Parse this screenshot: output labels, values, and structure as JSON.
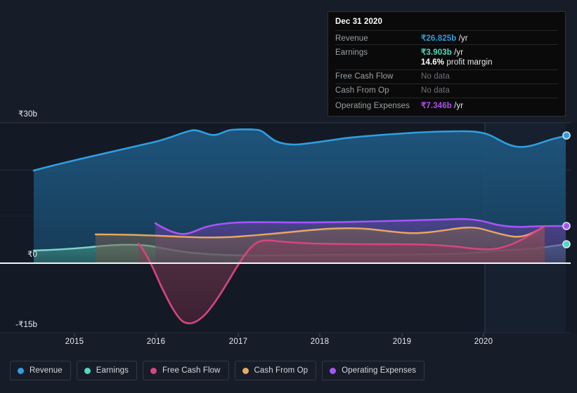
{
  "tooltip": {
    "title": "Dec 31 2020",
    "rows": [
      {
        "key": "Revenue",
        "value": "₹26.825b",
        "unit": " /yr",
        "color": "#2f9fe0",
        "muted": false
      },
      {
        "key": "Earnings",
        "value": "₹3.903b",
        "unit": " /yr",
        "color": "#4fd9c0",
        "muted": false
      },
      {
        "key": "",
        "value": "14.6%",
        "unit": " profit margin",
        "color": "#ffffff",
        "muted": false
      },
      {
        "key": "Free Cash Flow",
        "value": "No data",
        "unit": "",
        "color": "#6b7078",
        "muted": true
      },
      {
        "key": "Cash From Op",
        "value": "No data",
        "unit": "",
        "color": "#6b7078",
        "muted": true
      },
      {
        "key": "Operating Expenses",
        "value": "₹7.346b",
        "unit": " /yr",
        "color": "#b24ff0",
        "muted": false
      }
    ]
  },
  "legend": {
    "items": [
      {
        "label": "Revenue",
        "color": "#2f9fe0"
      },
      {
        "label": "Earnings",
        "color": "#4fd9c0"
      },
      {
        "label": "Free Cash Flow",
        "color": "#d6457f"
      },
      {
        "label": "Cash From Op",
        "color": "#e9a martial"
      },
      {
        "label": "Operating Expenses",
        "color": "#a855f7"
      }
    ]
  },
  "chart_data": {
    "type": "area",
    "title": "",
    "xlabel": "",
    "ylabel": "",
    "ylim": [
      -15,
      30
    ],
    "y_ticks": [
      30,
      0,
      -15
    ],
    "y_tick_labels": [
      "₹30b",
      "₹0",
      "-₹15b"
    ],
    "x_ticks": [
      "2015",
      "2016",
      "2017",
      "2018",
      "2019",
      "2020"
    ],
    "xlim": [
      "2014.5",
      "2021.0"
    ],
    "currency": "₹",
    "units": "billions",
    "grid": true,
    "legend_position": "bottom",
    "series": [
      {
        "name": "Revenue",
        "color": "#2f9fe0",
        "fill": "#1d4a6b",
        "points": [
          [
            2014.62,
            19.8
          ],
          [
            2015.0,
            21.2
          ],
          [
            2015.4,
            22.3
          ],
          [
            2015.8,
            23.5
          ],
          [
            2016.0,
            24.2
          ],
          [
            2016.2,
            25.3
          ],
          [
            2016.4,
            24.6
          ],
          [
            2016.6,
            24.2
          ],
          [
            2016.8,
            27.0
          ],
          [
            2017.0,
            27.8
          ],
          [
            2017.2,
            27.9
          ],
          [
            2017.45,
            27.7
          ],
          [
            2017.7,
            26.0
          ],
          [
            2018.0,
            25.6
          ],
          [
            2018.4,
            25.9
          ],
          [
            2018.7,
            26.6
          ],
          [
            2019.0,
            26.8
          ],
          [
            2019.4,
            27.1
          ],
          [
            2019.8,
            27.6
          ],
          [
            2020.1,
            27.8
          ],
          [
            2020.4,
            26.6
          ],
          [
            2020.6,
            25.9
          ],
          [
            2020.8,
            26.4
          ],
          [
            2021.0,
            26.825
          ]
        ]
      },
      {
        "name": "Earnings",
        "color": "#7fd6cd",
        "fill": "#2f6a66",
        "points": [
          [
            2014.62,
            2.6
          ],
          [
            2015.0,
            2.5
          ],
          [
            2015.4,
            2.5
          ],
          [
            2015.8,
            2.8
          ],
          [
            2016.0,
            2.9
          ],
          [
            2016.3,
            2.6
          ],
          [
            2016.6,
            2.1
          ],
          [
            2017.0,
            1.9
          ],
          [
            2017.4,
            1.9
          ],
          [
            2017.8,
            2.0
          ],
          [
            2018.2,
            1.9
          ],
          [
            2018.6,
            2.0
          ],
          [
            2019.0,
            2.0
          ],
          [
            2019.4,
            1.9
          ],
          [
            2019.8,
            2.0
          ],
          [
            2020.1,
            2.2
          ],
          [
            2020.4,
            2.1
          ],
          [
            2020.7,
            2.5
          ],
          [
            2021.0,
            3.903
          ]
        ]
      },
      {
        "name": "Free Cash Flow",
        "color": "#d6457f",
        "fill": "#5c2538",
        "points": [
          [
            2015.62,
            2.0
          ],
          [
            2015.8,
            -1.5
          ],
          [
            2016.0,
            -5.5
          ],
          [
            2016.2,
            -9.5
          ],
          [
            2016.35,
            -11.8
          ],
          [
            2016.5,
            -12.6
          ],
          [
            2016.65,
            -12.3
          ],
          [
            2016.8,
            -10.5
          ],
          [
            2017.0,
            -6.5
          ],
          [
            2017.15,
            -2.0
          ],
          [
            2017.3,
            1.2
          ],
          [
            2017.45,
            2.1
          ],
          [
            2017.7,
            2.3
          ],
          [
            2018.0,
            2.2
          ],
          [
            2018.4,
            2.1
          ],
          [
            2018.8,
            2.1
          ],
          [
            2019.2,
            2.2
          ],
          [
            2019.6,
            2.0
          ],
          [
            2019.9,
            1.6
          ],
          [
            2020.2,
            1.6
          ],
          [
            2020.5,
            2.6
          ],
          [
            2020.7,
            4.0
          ]
        ]
      },
      {
        "name": "Cash From Op",
        "color": "#e8a862",
        "fill": "#6b5340",
        "points": [
          [
            2015.05,
            6.0
          ],
          [
            2015.5,
            5.9
          ],
          [
            2016.0,
            5.7
          ],
          [
            2016.4,
            5.4
          ],
          [
            2016.8,
            5.6
          ],
          [
            2017.2,
            6.1
          ],
          [
            2017.6,
            6.5
          ],
          [
            2018.0,
            6.9
          ],
          [
            2018.3,
            6.6
          ],
          [
            2018.7,
            6.3
          ],
          [
            2019.1,
            6.3
          ],
          [
            2019.5,
            6.8
          ],
          [
            2019.8,
            7.0
          ],
          [
            2020.1,
            6.4
          ],
          [
            2020.35,
            6.0
          ],
          [
            2020.55,
            6.4
          ],
          [
            2020.7,
            7.4
          ]
        ]
      },
      {
        "name": "Operating Expenses",
        "color": "#a855f7",
        "fill": "#4a3270",
        "points": [
          [
            2015.72,
            8.5
          ],
          [
            2015.9,
            7.6
          ],
          [
            2016.05,
            6.9
          ],
          [
            2016.2,
            6.7
          ],
          [
            2016.4,
            7.0
          ],
          [
            2016.6,
            7.4
          ],
          [
            2016.9,
            7.5
          ],
          [
            2017.3,
            7.4
          ],
          [
            2017.7,
            7.3
          ],
          [
            2018.1,
            7.3
          ],
          [
            2018.5,
            7.4
          ],
          [
            2019.0,
            7.5
          ],
          [
            2019.5,
            7.6
          ],
          [
            2019.9,
            7.8
          ],
          [
            2020.2,
            7.5
          ],
          [
            2020.5,
            7.3
          ],
          [
            2020.75,
            7.35
          ],
          [
            2021.0,
            7.346
          ]
        ]
      }
    ],
    "endpoints": [
      {
        "name": "Revenue",
        "value": 26.825,
        "color": "#2f9fe0"
      },
      {
        "name": "Operating Expenses",
        "value": 7.346,
        "color": "#a855f7"
      },
      {
        "name": "Earnings",
        "value": 3.903,
        "color": "#4fd9c0"
      }
    ],
    "highlight_band": {
      "from": "2019.85",
      "to": "2021.0"
    }
  }
}
